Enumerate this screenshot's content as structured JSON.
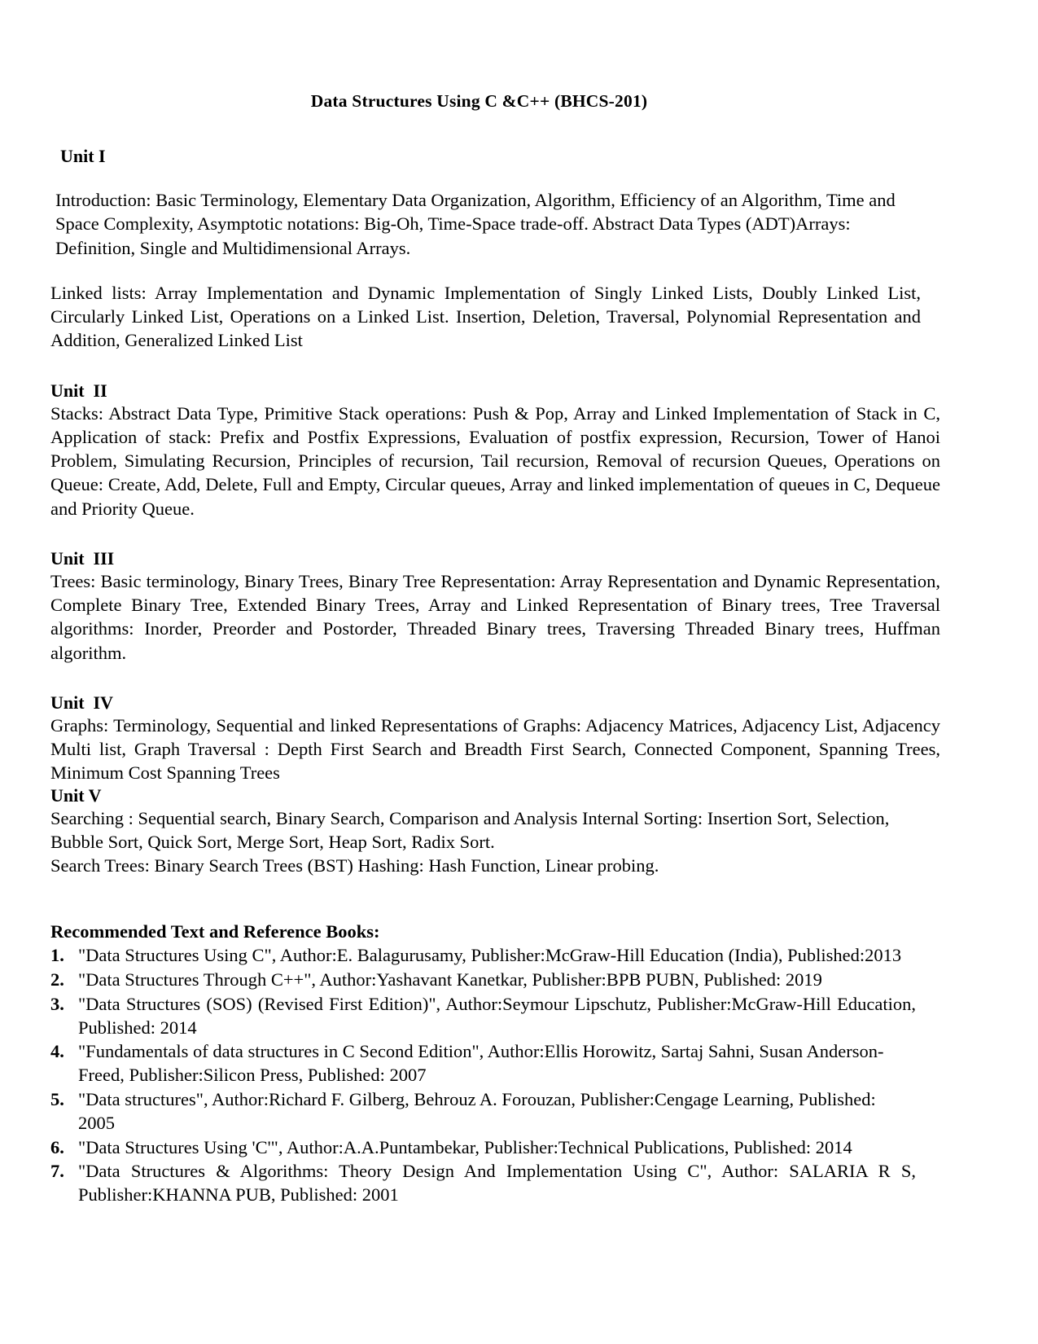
{
  "document": {
    "title": "Data Structures Using C &C++   (BHCS-201)",
    "units": [
      {
        "heading": "Unit I",
        "paragraphs": [
          "Introduction: Basic Terminology, Elementary Data Organization, Algorithm, Efficiency of an Algorithm, Time and Space Complexity, Asymptotic notations: Big-Oh, Time-Space trade-off. Abstract Data Types (ADT)Arrays: Definition, Single and Multidimensional Arrays.",
          "Linked lists: Array Implementation and Dynamic Implementation of Singly Linked Lists, Doubly Linked List, Circularly Linked List, Operations on a Linked List. Insertion, Deletion, Traversal, Polynomial Representation and Addition, Generalized Linked List"
        ]
      },
      {
        "heading": "Unit  II",
        "paragraphs": [
          "Stacks: Abstract Data Type, Primitive Stack operations: Push & Pop, Array and Linked Implementation of Stack in C, Application of stack: Prefix and Postfix Expressions, Evaluation of postfix expression, Recursion, Tower of Hanoi Problem, Simulating Recursion, Principles of recursion, Tail recursion, Removal of recursion Queues, Operations on Queue: Create, Add, Delete, Full and Empty, Circular queues, Array and linked implementation of queues in C, Dequeue and Priority Queue."
        ]
      },
      {
        "heading": "Unit  III",
        "paragraphs": [
          "Trees: Basic terminology, Binary Trees, Binary Tree Representation: Array Representation and Dynamic Representation, Complete Binary Tree, Extended Binary Trees, Array and Linked Representation of Binary trees, Tree Traversal algorithms: Inorder, Preorder and Postorder, Threaded Binary trees, Traversing Threaded Binary trees, Huffman algorithm."
        ]
      },
      {
        "heading": "Unit  IV",
        "paragraphs": [
          "Graphs: Terminology, Sequential and linked Representations of Graphs: Adjacency Matrices, Adjacency List, Adjacency Multi list, Graph Traversal : Depth First Search and Breadth First Search, Connected Component, Spanning Trees, Minimum Cost Spanning Trees"
        ]
      },
      {
        "heading": "Unit V",
        "paragraphs": [
          "Searching : Sequential search, Binary Search, Comparison and Analysis Internal Sorting: Insertion Sort, Selection, Bubble Sort, Quick Sort, Merge Sort, Heap Sort, Radix Sort.",
          "Search Trees: Binary Search Trees (BST) Hashing: Hash Function, Linear probing."
        ]
      }
    ],
    "references": {
      "heading": "Recommended Text and Reference Books:",
      "items": [
        {
          "number": "1.",
          "text": "\"Data Structures Using C\", Author:E. Balagurusamy, Publisher:McGraw-Hill Education (India), Published:2013"
        },
        {
          "number": "2.",
          "text": "\"Data Structures Through C++\", Author:Yashavant Kanetkar, Publisher:BPB PUBN, Published: 2019"
        },
        {
          "number": "3.",
          "text": "\"Data Structures (SOS) (Revised First Edition)\", Author:Seymour Lipschutz, Publisher:McGraw-Hill Education, Published: 2014"
        },
        {
          "number": "4.",
          "text": "\"Fundamentals of data structures in C Second Edition\", Author:Ellis Horowitz, Sartaj Sahni, Susan Anderson-Freed, Publisher:Silicon Press, Published: 2007"
        },
        {
          "number": "5.",
          "text": "\"Data structures\", Author:Richard F. Gilberg, Behrouz A. Forouzan, Publisher:Cengage Learning, Published: 2005"
        },
        {
          "number": "6.",
          "text": "\"Data Structures Using 'C'\", Author:A.A.Puntambekar, Publisher:Technical Publications, Published: 2014"
        },
        {
          "number": "7.",
          "text": "\"Data Structures & Algorithms: Theory Design And Implementation Using C\", Author: SALARIA R S, Publisher:KHANNA PUB, Published: 2001"
        }
      ]
    }
  }
}
